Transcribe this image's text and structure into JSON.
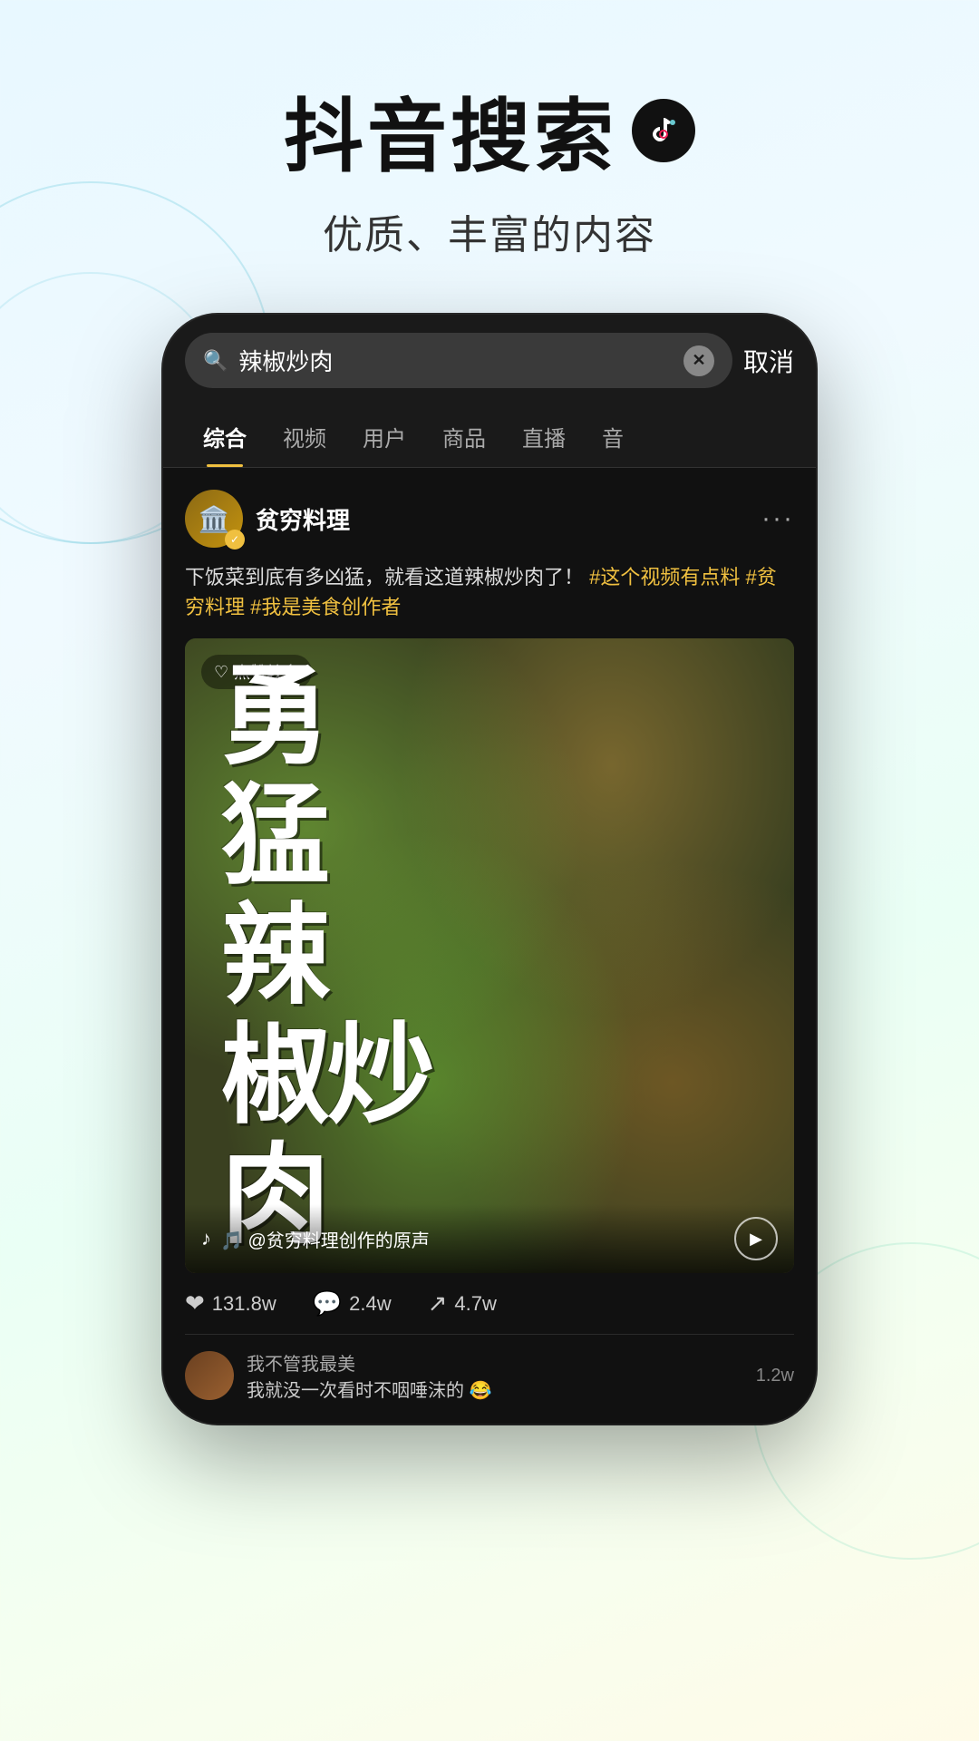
{
  "hero": {
    "title": "抖音搜索",
    "subtitle": "优质、丰富的内容"
  },
  "search": {
    "placeholder": "辣椒炒肉",
    "value": "辣椒炒肉",
    "cancel_label": "取消"
  },
  "tabs": [
    {
      "label": "综合",
      "active": true
    },
    {
      "label": "视频",
      "active": false
    },
    {
      "label": "用户",
      "active": false
    },
    {
      "label": "商品",
      "active": false
    },
    {
      "label": "直播",
      "active": false
    },
    {
      "label": "音",
      "active": false
    }
  ],
  "post": {
    "username": "贫穷料理",
    "description": "下饭菜到底有多凶猛，就看这道辣椒炒肉了！",
    "hashtags": [
      "#这个视频有点料",
      "#贫穷料理",
      "#我是美食创作者"
    ],
    "likes_badge": "点赞较多",
    "video_text": "勇猛辣椒炒肉",
    "video_calligraphy_lines": [
      "勇",
      "猛",
      "辣",
      "椒炒",
      "肉"
    ],
    "audio_info": "🎵 @贫穷料理创作的原声",
    "engagement": {
      "likes": "131.8w",
      "comments": "2.4w",
      "shares": "4.7w"
    },
    "comment_preview": {
      "commenter": "我不管我最美",
      "text": "我就没一次看时不咽唾沫的 😂",
      "count": "1.2w"
    }
  },
  "icons": {
    "search": "🔍",
    "clear": "✕",
    "heart": "♡",
    "heart_filled": "❤",
    "comment": "💬",
    "share": "↗",
    "play": "▶",
    "music": "♪",
    "more": "···",
    "verified": "✓"
  }
}
